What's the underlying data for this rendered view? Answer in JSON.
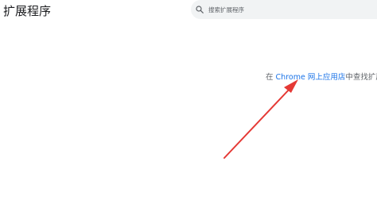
{
  "header": {
    "title": "扩展程序"
  },
  "search": {
    "placeholder": "搜索扩展程序",
    "icon": "search-icon"
  },
  "main": {
    "prefix": "在 ",
    "store_link": "Chrome 网上应用店",
    "suffix": "中查找扩展"
  },
  "annotation": {
    "color": "#e53935"
  }
}
